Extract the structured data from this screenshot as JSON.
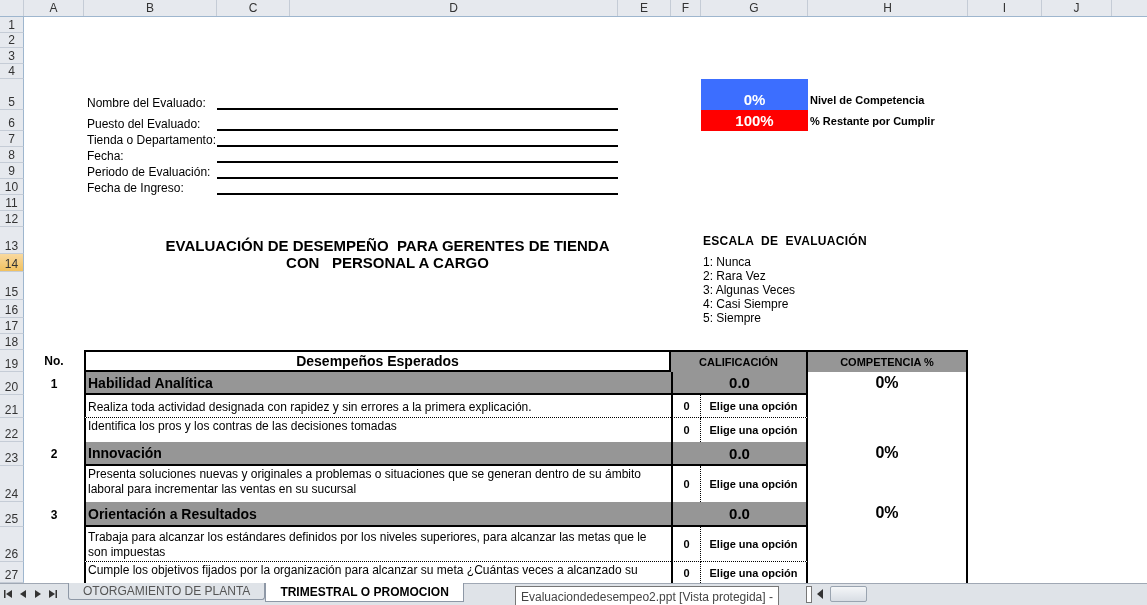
{
  "columns": [
    "A",
    "B",
    "C",
    "D",
    "E",
    "F",
    "G",
    "H",
    "I",
    "J"
  ],
  "rows": [
    {
      "label": "1",
      "selected": false
    },
    {
      "label": "2",
      "selected": false
    },
    {
      "label": "3",
      "selected": false
    },
    {
      "label": "4",
      "selected": false
    },
    {
      "label": "5",
      "selected": false
    },
    {
      "label": "6",
      "selected": false
    },
    {
      "label": "7",
      "selected": false
    },
    {
      "label": "8",
      "selected": false
    },
    {
      "label": "9",
      "selected": false
    },
    {
      "label": "10",
      "selected": false
    },
    {
      "label": "11",
      "selected": false
    },
    {
      "label": "12",
      "selected": false
    },
    {
      "label": "13",
      "selected": false
    },
    {
      "label": "14",
      "selected": true
    },
    {
      "label": "15",
      "selected": false
    },
    {
      "label": "16",
      "selected": false
    },
    {
      "label": "17",
      "selected": false
    },
    {
      "label": "18",
      "selected": false
    },
    {
      "label": "19",
      "selected": false
    },
    {
      "label": "20",
      "selected": false
    },
    {
      "label": "21",
      "selected": false
    },
    {
      "label": "22",
      "selected": false
    },
    {
      "label": "23",
      "selected": false
    },
    {
      "label": "24",
      "selected": false
    },
    {
      "label": "25",
      "selected": false
    },
    {
      "label": "26",
      "selected": false
    },
    {
      "label": "27",
      "selected": false
    }
  ],
  "form": {
    "fields": [
      {
        "label": "Nombre del Evaluado:"
      },
      {
        "label": "Puesto del Evaluado:"
      },
      {
        "label": "Tienda o Departamento:"
      },
      {
        "label": "Fecha:"
      },
      {
        "label": "Periodo de Evaluación:"
      },
      {
        "label": "Fecha de Ingreso:"
      }
    ]
  },
  "indicators": [
    {
      "value": "0%",
      "label": "Nivel de Competencia",
      "color": "#3c6eff"
    },
    {
      "value": "100%",
      "label": "% Restante por Cumplir",
      "color": "#ff0000"
    }
  ],
  "title_lines": [
    "EVALUACIÓN DE DESEMPEÑO  PARA GERENTES DE TIENDA",
    "CON   PERSONAL A CARGO"
  ],
  "scale": {
    "title": "ESCALA  DE  EVALUACIÓN",
    "items": [
      "1: Nunca",
      "2: Rara Vez",
      "3: Algunas Veces",
      "4: Casi Siempre",
      "5: Siempre"
    ]
  },
  "table": {
    "headers": {
      "number": "No.",
      "description": "Desempeños Esperados",
      "rating": "CALIFICACIÓN",
      "competence": "COMPETENCIA %"
    },
    "sections": [
      {
        "number": "1",
        "title": "Habilidad Analítica",
        "score": "0.0",
        "competence": "0%",
        "items": [
          {
            "text": "Realiza toda actividad designada con rapidez y  sin errores a la primera explicación.",
            "value": "0",
            "choice": "Elige una opción"
          },
          {
            "text": "Identifica los pros y los contras de las decisiones tomadas",
            "value": "0",
            "choice": "Elige una opción"
          }
        ]
      },
      {
        "number": "2",
        "title": "Innovación",
        "score": "0.0",
        "competence": "0%",
        "items": [
          {
            "text": "Presenta soluciones nuevas y originales a problemas o situaciones que se generan dentro de su ámbito laboral para incrementar las ventas en su sucursal",
            "value": "0",
            "choice": "Elige una opción"
          }
        ]
      },
      {
        "number": "3",
        "title": "Orientación a Resultados",
        "score": "0.0",
        "competence": "0%",
        "items": [
          {
            "text": "Trabaja para alcanzar los estándares definidos por los niveles superiores, para alcanzar las metas que le son impuestas",
            "value": "0",
            "choice": "Elige una opción"
          },
          {
            "text": "Cumple los objetivos fijados por la organización para alcanzar su meta  ¿Cuántas veces a alcanzado su",
            "value": "0",
            "choice": "Elige una opción"
          }
        ]
      }
    ]
  },
  "sheet_tabs": [
    {
      "label": "OTORGAMIENTO DE PLANTA",
      "selected": false
    },
    {
      "label": "TRIMESTRAL O PROMOCION",
      "selected": true
    }
  ],
  "taskbar_tooltip": "Evaluaciondedesempeo2.ppt [Vista protegida] -"
}
